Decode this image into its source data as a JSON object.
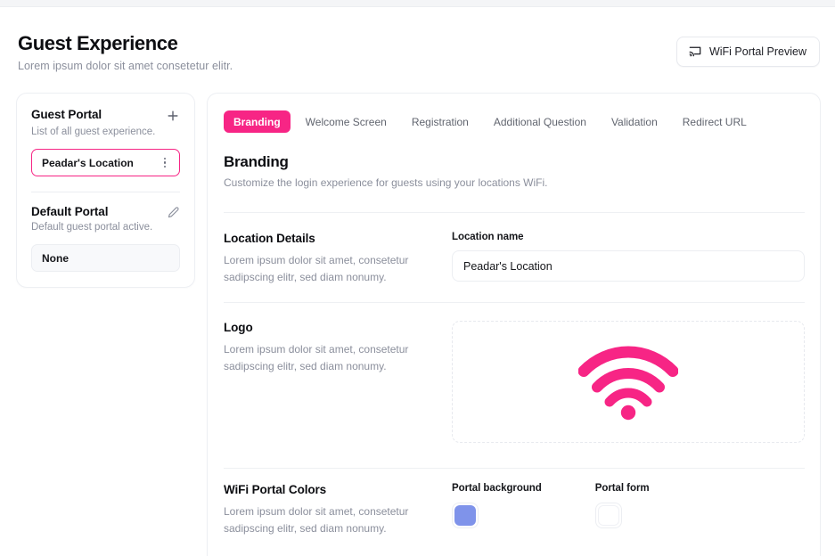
{
  "header": {
    "title": "Guest Experience",
    "subtitle": "Lorem ipsum dolor sit amet consetetur elitr.",
    "preview_button": {
      "label": "WiFi Portal Preview",
      "icon": "cast-screen-icon"
    }
  },
  "sidebar": {
    "guest_portal": {
      "title": "Guest Portal",
      "subtitle": "List of all guest experience.",
      "add_icon": "plus-icon",
      "items": [
        {
          "label": "Peadar's Location",
          "selected": true,
          "menu_icon": "more-vertical-icon"
        }
      ]
    },
    "default_portal": {
      "title": "Default Portal",
      "subtitle": "Default guest portal active.",
      "edit_icon": "pencil-icon",
      "value": "None"
    }
  },
  "main": {
    "tabs": [
      {
        "label": "Branding",
        "active": true
      },
      {
        "label": "Welcome Screen",
        "active": false
      },
      {
        "label": "Registration",
        "active": false
      },
      {
        "label": "Additional Question",
        "active": false
      },
      {
        "label": "Validation",
        "active": false
      },
      {
        "label": "Redirect URL",
        "active": false
      }
    ],
    "panel": {
      "title": "Branding",
      "description": "Customize the login experience for guests using your locations WiFi."
    },
    "sections": {
      "location_details": {
        "title": "Location Details",
        "description": "Lorem ipsum dolor sit amet, consetetur sadipscing elitr, sed diam nonumy.",
        "field_label": "Location name",
        "field_value": "Peadar's Location",
        "field_placeholder": "Location name"
      },
      "logo": {
        "title": "Logo",
        "description": "Lorem ipsum dolor sit amet, consetetur sadipscing elitr, sed diam nonumy.",
        "dropzone_icon": "wifi-logo-icon"
      },
      "portal_colors": {
        "title": "WiFi Portal Colors",
        "description": "Lorem ipsum dolor sit amet, consetetur sadipscing elitr, sed diam nonumy.",
        "background_label": "Portal background",
        "background_color": "#7f93ea",
        "form_label": "Portal form",
        "form_color": "#ffffff"
      }
    }
  },
  "theme": {
    "accent": "#f72585",
    "text": "#15161a",
    "muted": "#8b8f9c",
    "border": "#eceef2"
  }
}
